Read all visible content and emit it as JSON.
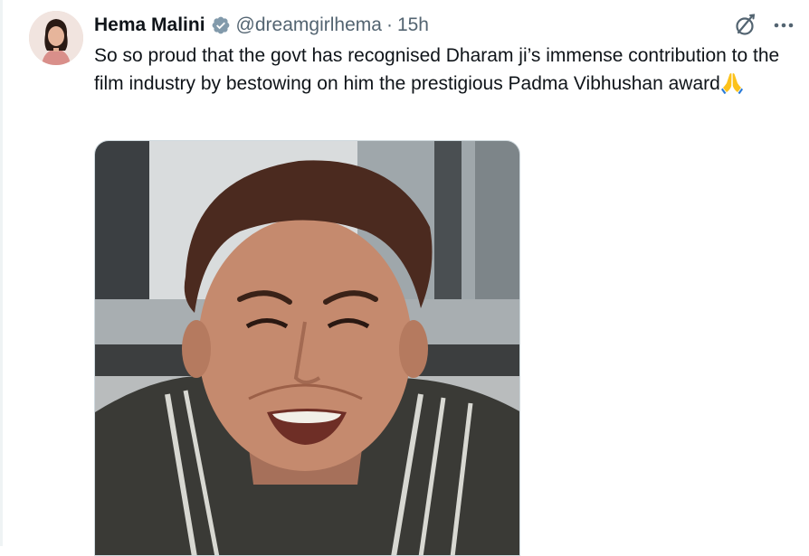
{
  "author": {
    "display_name": "Hema Malini",
    "handle": "@dreamgirlhema",
    "separator": "·",
    "time": "15h",
    "verified": true,
    "avatar_icon": "profile-photo"
  },
  "tweet": {
    "text": "So so proud that the govt has recognised Dharam ji’s immense contribution to the film industry by bestowing on him the prestigious Padma Vibhushan award",
    "trailing_emoji": "folded-hands-icon"
  },
  "media": {
    "type": "photo",
    "subject": "photo-of-smiling-man"
  },
  "actions": {
    "grok_icon": "grok-icon",
    "more_icon": "more-icon"
  },
  "colors": {
    "text": "#0f1419",
    "secondary": "#536471",
    "verified_badge": "#829aab",
    "border": "#cfd9de"
  }
}
